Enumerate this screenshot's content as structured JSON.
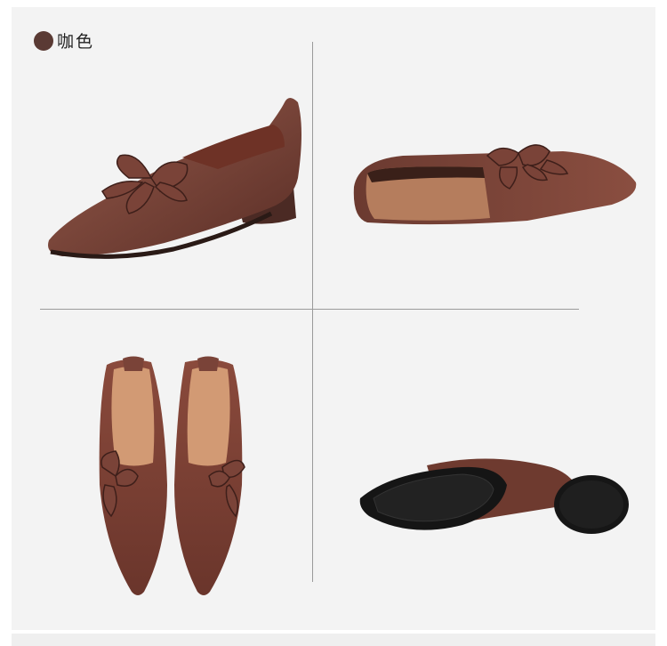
{
  "color_option": {
    "label": "咖色",
    "swatch_color": "#5a3a34"
  },
  "colors": {
    "leather": "#7a4338",
    "leather_dark": "#5a2e26",
    "leather_light": "#955a4b",
    "lining": "#c98e6b",
    "heel": "#4b2a24",
    "sole": "#1a1a1a",
    "panel_bg": "#f3f3f3",
    "divider": "#9a9a9a"
  },
  "views": [
    {
      "id": "side-view"
    },
    {
      "id": "angled-view"
    },
    {
      "id": "top-view-pair"
    },
    {
      "id": "sole-view"
    }
  ]
}
